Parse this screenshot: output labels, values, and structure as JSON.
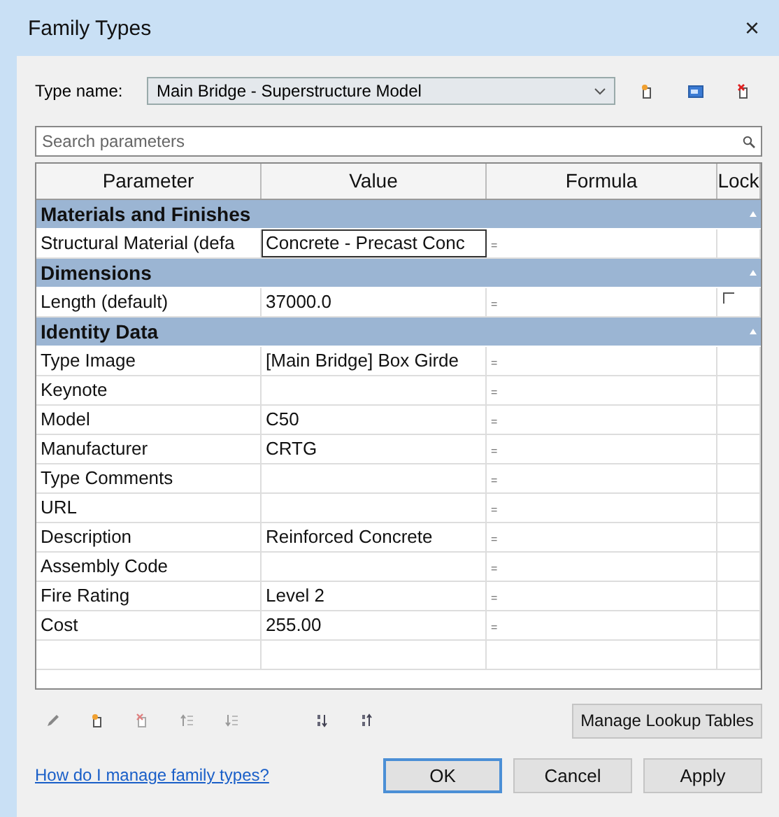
{
  "window": {
    "title": "Family Types",
    "close": "×"
  },
  "type_name": {
    "label": "Type name:",
    "value": "Main Bridge - Superstructure Model"
  },
  "search": {
    "placeholder": "Search parameters"
  },
  "table": {
    "columns": [
      "Parameter",
      "Value",
      "Formula",
      "Lock"
    ],
    "groups": [
      {
        "name": "Materials and Finishes",
        "expanded": true,
        "rows": [
          {
            "parameter": "Structural Material (defa",
            "value": "Concrete - Precast Conc",
            "formula": "=",
            "selected": true
          }
        ]
      },
      {
        "name": "Dimensions",
        "expanded": true,
        "rows": [
          {
            "parameter": "Length (default)",
            "value": "37000.0",
            "formula": "=",
            "selected": false,
            "locked": false
          }
        ]
      },
      {
        "name": "Identity Data",
        "expanded": true,
        "rows": [
          {
            "parameter": "Type Image",
            "value": "[Main Bridge] Box Girde",
            "formula": "=",
            "selected": false
          },
          {
            "parameter": "Keynote",
            "formula": "=",
            "selected": false
          },
          {
            "parameter": "Model",
            "value": "C50",
            "formula": "=",
            "selected": false
          },
          {
            "parameter": "Manufacturer",
            "value": "CRTG",
            "formula": "=",
            "selected": false
          },
          {
            "parameter": "Type Comments",
            "formula": "=",
            "selected": false
          },
          {
            "parameter": "URL",
            "formula": "=",
            "selected": false
          },
          {
            "parameter": "Description",
            "value": "Reinforced Concrete",
            "formula": "=",
            "selected": false
          },
          {
            "parameter": "Assembly Code",
            "formula": "=",
            "selected": false
          },
          {
            "parameter": "Fire Rating",
            "value": "Level 2",
            "formula": "=",
            "selected": false
          },
          {
            "parameter": "Cost",
            "value": "255.00",
            "formula": "=",
            "selected": false
          }
        ]
      }
    ]
  },
  "manage_lookup_button": "Manage Lookup Tables",
  "help_link": "How do I manage family types?",
  "buttons": [
    {
      "label": "OK",
      "default": true
    },
    {
      "label": "Cancel",
      "default": false
    },
    {
      "label": "Apply",
      "default": false
    }
  ]
}
